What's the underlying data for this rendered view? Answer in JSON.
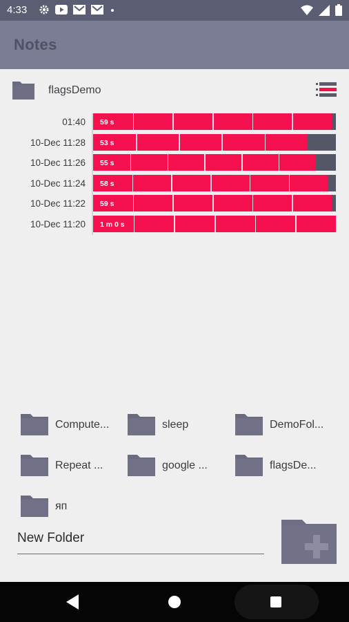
{
  "status_bar": {
    "time": "4:33",
    "icons": [
      "gear-icon",
      "youtube-icon",
      "gmail-icon",
      "gmail-icon",
      "dot-icon"
    ],
    "right_icons": [
      "wifi-icon",
      "signal-icon",
      "battery-icon"
    ]
  },
  "app_bar": {
    "title": "Notes"
  },
  "current_folder": {
    "name": "flagsDemo",
    "view_toggle_icon": "list-view-icon"
  },
  "colors": {
    "accent": "#f5114f",
    "app_bar": "#7a7d93",
    "status_bar": "#5b5e72",
    "track": "#545866",
    "folder": "#6b6b80"
  },
  "timeline": [
    {
      "label": "01:40",
      "duration": "59 s",
      "fill_fraction": 0.983
    },
    {
      "label": "10-Dec 11:28",
      "duration": "53 s",
      "fill_fraction": 0.883
    },
    {
      "label": "10-Dec 11:26",
      "duration": "55 s",
      "fill_fraction": 0.917
    },
    {
      "label": "10-Dec 11:24",
      "duration": "58 s",
      "fill_fraction": 0.967
    },
    {
      "label": "10-Dec 11:22",
      "duration": "59 s",
      "fill_fraction": 0.983
    },
    {
      "label": "10-Dec 11:20",
      "duration": "1 m 0 s",
      "fill_fraction": 1.0
    }
  ],
  "folders": [
    {
      "label": "Compute..."
    },
    {
      "label": "sleep"
    },
    {
      "label": "DemoFol..."
    },
    {
      "label": "Repeat ..."
    },
    {
      "label": "google ..."
    },
    {
      "label": "flagsDe..."
    },
    {
      "label": "яп"
    }
  ],
  "new_folder": {
    "value": "New Folder",
    "button_icon": "add-folder-icon"
  },
  "nav": {
    "icons": [
      "back-icon",
      "home-icon",
      "recents-icon"
    ]
  }
}
